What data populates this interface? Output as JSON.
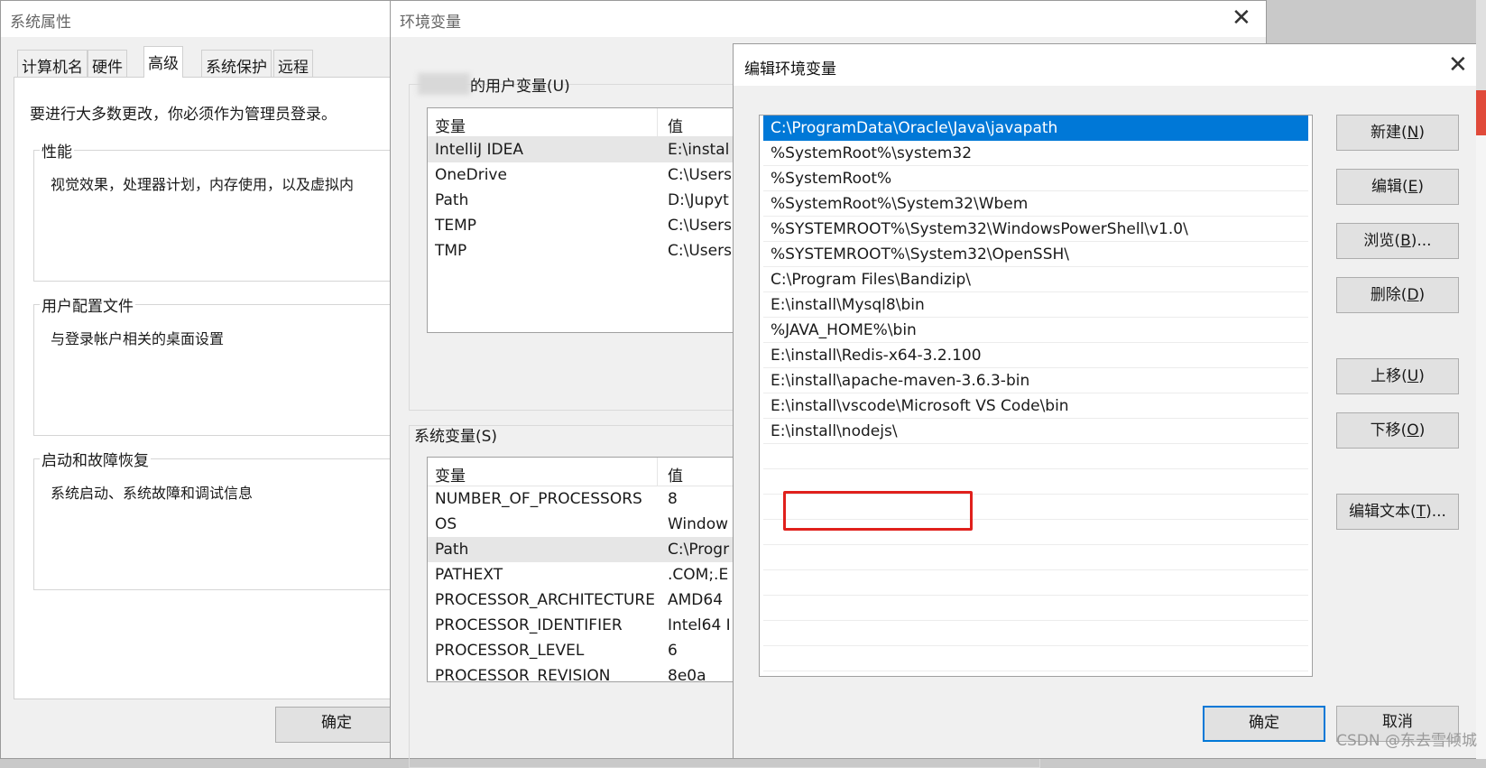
{
  "system_properties": {
    "title": "系统属性",
    "tabs": [
      "计算机名",
      "硬件",
      "高级",
      "系统保护",
      "远程"
    ],
    "active_tab": "高级",
    "intro": "要进行大多数更改，你必须作为管理员登录。",
    "performance": {
      "title": "性能",
      "desc": "视觉效果，处理器计划，内存使用，以及虚拟内"
    },
    "profile": {
      "title": "用户配置文件",
      "desc": "与登录帐户相关的桌面设置"
    },
    "startup": {
      "title": "启动和故障恢复",
      "desc": "系统启动、系统故障和调试信息"
    },
    "ok_label": "确定"
  },
  "env_vars": {
    "title": "环境变量",
    "user_section_label": "的用户变量(U)",
    "user_table": {
      "headers": [
        "变量",
        "值"
      ],
      "rows": [
        [
          "IntelliJ IDEA",
          "E:\\instal"
        ],
        [
          "OneDrive",
          "C:\\Users"
        ],
        [
          "Path",
          "D:\\Jupyt"
        ],
        [
          "TEMP",
          "C:\\Users"
        ],
        [
          "TMP",
          "C:\\Users"
        ]
      ]
    },
    "system_section_label": "系统变量(S)",
    "system_table": {
      "headers": [
        "变量",
        "值"
      ],
      "rows": [
        [
          "NUMBER_OF_PROCESSORS",
          "8"
        ],
        [
          "OS",
          "Window"
        ],
        [
          "Path",
          "C:\\Progr"
        ],
        [
          "PATHEXT",
          ".COM;.E"
        ],
        [
          "PROCESSOR_ARCHITECTURE",
          "AMD64"
        ],
        [
          "PROCESSOR_IDENTIFIER",
          "Intel64 I"
        ],
        [
          "PROCESSOR_LEVEL",
          "6"
        ],
        [
          "PROCESSOR_REVISION",
          "8e0a"
        ]
      ]
    }
  },
  "edit_env": {
    "title": "编辑环境变量",
    "paths": [
      "C:\\ProgramData\\Oracle\\Java\\javapath",
      "%SystemRoot%\\system32",
      "%SystemRoot%",
      "%SystemRoot%\\System32\\Wbem",
      "%SYSTEMROOT%\\System32\\WindowsPowerShell\\v1.0\\",
      "%SYSTEMROOT%\\System32\\OpenSSH\\",
      "C:\\Program Files\\Bandizip\\",
      "E:\\install\\Mysql8\\bin",
      "%JAVA_HOME%\\bin",
      "E:\\install\\Redis-x64-3.2.100",
      "E:\\install\\apache-maven-3.6.3-bin",
      "E:\\install\\vscode\\Microsoft VS Code\\bin",
      "E:\\install\\nodejs\\"
    ],
    "selected_index": 0,
    "highlighted_index": 12,
    "buttons": {
      "new": {
        "text": "新建(",
        "key": "N",
        "tail": ")"
      },
      "edit": {
        "text": "编辑(",
        "key": "E",
        "tail": ")"
      },
      "browse": {
        "text": "浏览(",
        "key": "B",
        "tail": ")..."
      },
      "delete": {
        "text": "删除(",
        "key": "D",
        "tail": ")"
      },
      "move_up": {
        "text": "上移(",
        "key": "U",
        "tail": ")"
      },
      "move_down": {
        "text": "下移(",
        "key": "O",
        "tail": ")"
      },
      "edit_text": {
        "text": "编辑文本(",
        "key": "T",
        "tail": ")..."
      }
    },
    "ok_label": "确定",
    "cancel_label": "取消"
  },
  "watermark": "CSDN @东去雪倾城",
  "colors": {
    "selection": "#0078d7",
    "highlight_box": "#e0201c"
  }
}
